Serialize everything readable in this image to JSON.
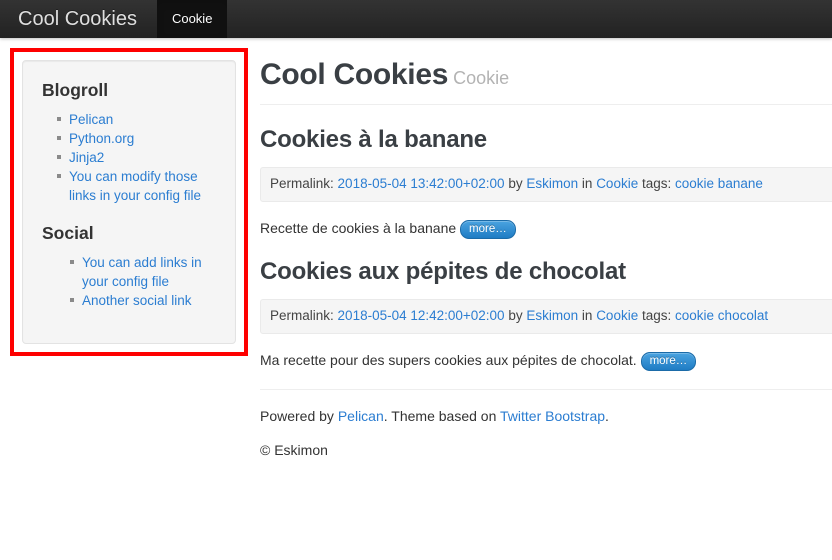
{
  "navbar": {
    "brand": "Cool Cookies",
    "items": [
      {
        "label": "Cookie",
        "active": true
      }
    ]
  },
  "sidebar": {
    "sections": [
      {
        "title": "Blogroll",
        "links": [
          "Pelican",
          "Python.org",
          "Jinja2",
          "You can modify those links in your config file"
        ]
      },
      {
        "title": "Social",
        "links": [
          "You can add links in your config file",
          "Another social link"
        ]
      }
    ],
    "highlight_color": "#fe0000"
  },
  "header": {
    "title": "Cool Cookies",
    "subtitle": "Cookie"
  },
  "articles": [
    {
      "title": "Cookies à la banane",
      "meta": {
        "permalink_label": "Permalink:",
        "date": "2018-05-04 13:42:00+02:00",
        "by_label": "by",
        "author": "Eskimon",
        "in_label": "in",
        "category": "Cookie",
        "tags_label": "tags:",
        "tags": [
          "cookie banane"
        ]
      },
      "summary": "Recette de cookies à la banane",
      "more_label": "more…"
    },
    {
      "title": "Cookies aux pépites de chocolat",
      "meta": {
        "permalink_label": "Permalink:",
        "date": "2018-05-04 12:42:00+02:00",
        "by_label": "by",
        "author": "Eskimon",
        "in_label": "in",
        "category": "Cookie",
        "tags_label": "tags:",
        "tags": [
          "cookie chocolat"
        ]
      },
      "summary": "Ma recette pour des supers cookies aux pépites de chocolat.",
      "more_label": "more…"
    }
  ],
  "footer": {
    "powered_by_label": "Powered by",
    "pelican_link": "Pelican",
    "powered_sep": ".",
    "theme_label": "Theme based on",
    "bootstrap_link": "Twitter Bootstrap",
    "theme_sep": ".",
    "copyright": "© Eskimon"
  },
  "colors": {
    "link": "#2b7dd1",
    "navbar_bg": "#222222",
    "navbar_active_bg": "#111111",
    "well_bg": "#f5f5f5",
    "highlight": "#fe0000",
    "badge": "#2f8fd8"
  }
}
